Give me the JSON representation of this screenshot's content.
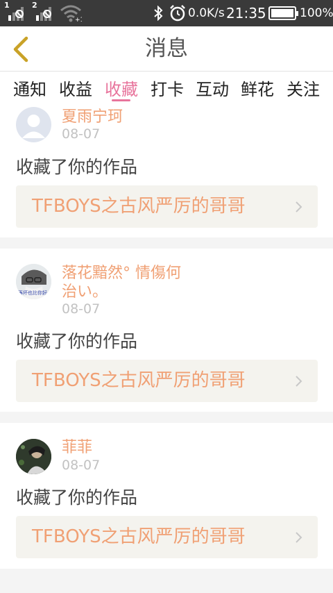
{
  "status_bar": {
    "sim1": "1",
    "sim2": "2",
    "net_speed": "0.0K/s",
    "time": "21:35",
    "battery": "100%",
    "battery_level": 1.0
  },
  "header": {
    "title": "消息",
    "back_icon": "chevron-left-icon"
  },
  "tabs": [
    {
      "label": "通知",
      "active": false
    },
    {
      "label": "收益",
      "active": false
    },
    {
      "label": "收藏",
      "active": true
    },
    {
      "label": "打卡",
      "active": false
    },
    {
      "label": "互动",
      "active": false
    },
    {
      "label": "鲜花",
      "active": false
    },
    {
      "label": "关注",
      "active": false
    }
  ],
  "colors": {
    "accent": "#e8749c",
    "username": "#f0a074",
    "work_bg": "#f4f3ee",
    "status_bar_bg": "#3a3a3a"
  },
  "messages": [
    {
      "username": "夏雨宁珂",
      "date": "08-07",
      "action": "收藏了你的作品",
      "work_title": "TFBOYS之古风严厉的哥哥"
    },
    {
      "username": "落花黯然°  情傷何治い。",
      "date": "08-07",
      "action": "收藏了你的作品",
      "work_title": "TFBOYS之古风严厉的哥哥",
      "avatar_caption": "再坏也比你好"
    },
    {
      "username": "菲菲",
      "date": "08-07",
      "action": "收藏了你的作品",
      "work_title": "TFBOYS之古风严厉的哥哥"
    }
  ]
}
